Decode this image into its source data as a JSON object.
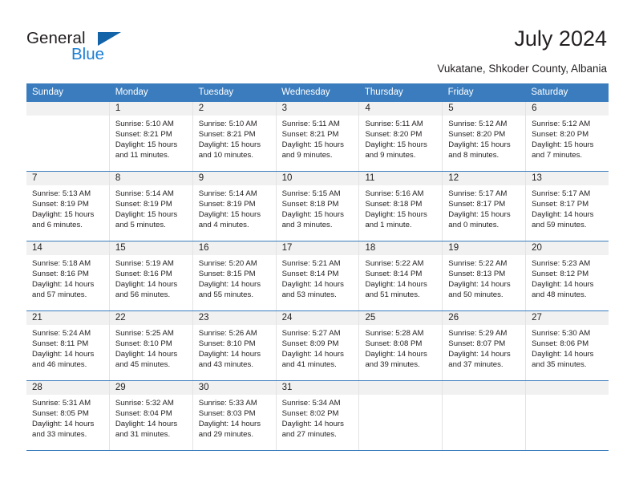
{
  "brand": {
    "name_part1": "General",
    "name_part2": "Blue",
    "logo_icon": "blue-triangle-icon",
    "accent_color": "#1c7fd4",
    "triangle_color": "#1363a8"
  },
  "header": {
    "title": "July 2024",
    "subtitle": "Vukatane, Shkoder County, Albania"
  },
  "calendar": {
    "header_bg": "#3a7cbe",
    "header_text_color": "#ffffff",
    "daynum_band_bg": "#f1f1f1",
    "weekdays": [
      "Sunday",
      "Monday",
      "Tuesday",
      "Wednesday",
      "Thursday",
      "Friday",
      "Saturday"
    ],
    "weeks": [
      [
        {
          "day": "",
          "lines": []
        },
        {
          "day": "1",
          "lines": [
            "Sunrise: 5:10 AM",
            "Sunset: 8:21 PM",
            "Daylight: 15 hours",
            "and 11 minutes."
          ]
        },
        {
          "day": "2",
          "lines": [
            "Sunrise: 5:10 AM",
            "Sunset: 8:21 PM",
            "Daylight: 15 hours",
            "and 10 minutes."
          ]
        },
        {
          "day": "3",
          "lines": [
            "Sunrise: 5:11 AM",
            "Sunset: 8:21 PM",
            "Daylight: 15 hours",
            "and 9 minutes."
          ]
        },
        {
          "day": "4",
          "lines": [
            "Sunrise: 5:11 AM",
            "Sunset: 8:20 PM",
            "Daylight: 15 hours",
            "and 9 minutes."
          ]
        },
        {
          "day": "5",
          "lines": [
            "Sunrise: 5:12 AM",
            "Sunset: 8:20 PM",
            "Daylight: 15 hours",
            "and 8 minutes."
          ]
        },
        {
          "day": "6",
          "lines": [
            "Sunrise: 5:12 AM",
            "Sunset: 8:20 PM",
            "Daylight: 15 hours",
            "and 7 minutes."
          ]
        }
      ],
      [
        {
          "day": "7",
          "lines": [
            "Sunrise: 5:13 AM",
            "Sunset: 8:19 PM",
            "Daylight: 15 hours",
            "and 6 minutes."
          ]
        },
        {
          "day": "8",
          "lines": [
            "Sunrise: 5:14 AM",
            "Sunset: 8:19 PM",
            "Daylight: 15 hours",
            "and 5 minutes."
          ]
        },
        {
          "day": "9",
          "lines": [
            "Sunrise: 5:14 AM",
            "Sunset: 8:19 PM",
            "Daylight: 15 hours",
            "and 4 minutes."
          ]
        },
        {
          "day": "10",
          "lines": [
            "Sunrise: 5:15 AM",
            "Sunset: 8:18 PM",
            "Daylight: 15 hours",
            "and 3 minutes."
          ]
        },
        {
          "day": "11",
          "lines": [
            "Sunrise: 5:16 AM",
            "Sunset: 8:18 PM",
            "Daylight: 15 hours",
            "and 1 minute."
          ]
        },
        {
          "day": "12",
          "lines": [
            "Sunrise: 5:17 AM",
            "Sunset: 8:17 PM",
            "Daylight: 15 hours",
            "and 0 minutes."
          ]
        },
        {
          "day": "13",
          "lines": [
            "Sunrise: 5:17 AM",
            "Sunset: 8:17 PM",
            "Daylight: 14 hours",
            "and 59 minutes."
          ]
        }
      ],
      [
        {
          "day": "14",
          "lines": [
            "Sunrise: 5:18 AM",
            "Sunset: 8:16 PM",
            "Daylight: 14 hours",
            "and 57 minutes."
          ]
        },
        {
          "day": "15",
          "lines": [
            "Sunrise: 5:19 AM",
            "Sunset: 8:16 PM",
            "Daylight: 14 hours",
            "and 56 minutes."
          ]
        },
        {
          "day": "16",
          "lines": [
            "Sunrise: 5:20 AM",
            "Sunset: 8:15 PM",
            "Daylight: 14 hours",
            "and 55 minutes."
          ]
        },
        {
          "day": "17",
          "lines": [
            "Sunrise: 5:21 AM",
            "Sunset: 8:14 PM",
            "Daylight: 14 hours",
            "and 53 minutes."
          ]
        },
        {
          "day": "18",
          "lines": [
            "Sunrise: 5:22 AM",
            "Sunset: 8:14 PM",
            "Daylight: 14 hours",
            "and 51 minutes."
          ]
        },
        {
          "day": "19",
          "lines": [
            "Sunrise: 5:22 AM",
            "Sunset: 8:13 PM",
            "Daylight: 14 hours",
            "and 50 minutes."
          ]
        },
        {
          "day": "20",
          "lines": [
            "Sunrise: 5:23 AM",
            "Sunset: 8:12 PM",
            "Daylight: 14 hours",
            "and 48 minutes."
          ]
        }
      ],
      [
        {
          "day": "21",
          "lines": [
            "Sunrise: 5:24 AM",
            "Sunset: 8:11 PM",
            "Daylight: 14 hours",
            "and 46 minutes."
          ]
        },
        {
          "day": "22",
          "lines": [
            "Sunrise: 5:25 AM",
            "Sunset: 8:10 PM",
            "Daylight: 14 hours",
            "and 45 minutes."
          ]
        },
        {
          "day": "23",
          "lines": [
            "Sunrise: 5:26 AM",
            "Sunset: 8:10 PM",
            "Daylight: 14 hours",
            "and 43 minutes."
          ]
        },
        {
          "day": "24",
          "lines": [
            "Sunrise: 5:27 AM",
            "Sunset: 8:09 PM",
            "Daylight: 14 hours",
            "and 41 minutes."
          ]
        },
        {
          "day": "25",
          "lines": [
            "Sunrise: 5:28 AM",
            "Sunset: 8:08 PM",
            "Daylight: 14 hours",
            "and 39 minutes."
          ]
        },
        {
          "day": "26",
          "lines": [
            "Sunrise: 5:29 AM",
            "Sunset: 8:07 PM",
            "Daylight: 14 hours",
            "and 37 minutes."
          ]
        },
        {
          "day": "27",
          "lines": [
            "Sunrise: 5:30 AM",
            "Sunset: 8:06 PM",
            "Daylight: 14 hours",
            "and 35 minutes."
          ]
        }
      ],
      [
        {
          "day": "28",
          "lines": [
            "Sunrise: 5:31 AM",
            "Sunset: 8:05 PM",
            "Daylight: 14 hours",
            "and 33 minutes."
          ]
        },
        {
          "day": "29",
          "lines": [
            "Sunrise: 5:32 AM",
            "Sunset: 8:04 PM",
            "Daylight: 14 hours",
            "and 31 minutes."
          ]
        },
        {
          "day": "30",
          "lines": [
            "Sunrise: 5:33 AM",
            "Sunset: 8:03 PM",
            "Daylight: 14 hours",
            "and 29 minutes."
          ]
        },
        {
          "day": "31",
          "lines": [
            "Sunrise: 5:34 AM",
            "Sunset: 8:02 PM",
            "Daylight: 14 hours",
            "and 27 minutes."
          ]
        },
        {
          "day": "",
          "lines": []
        },
        {
          "day": "",
          "lines": []
        },
        {
          "day": "",
          "lines": []
        }
      ]
    ]
  }
}
